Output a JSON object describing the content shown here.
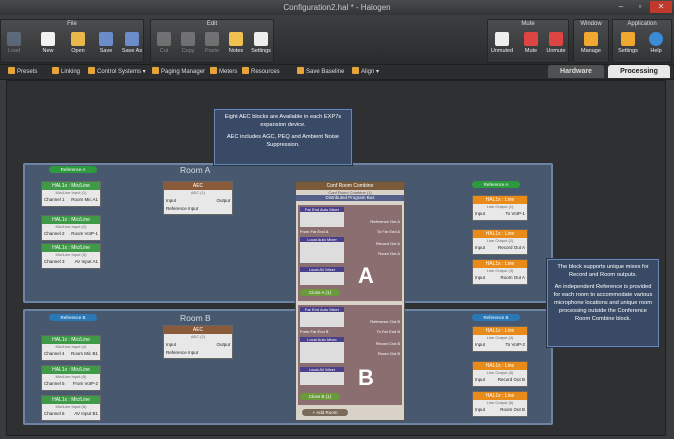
{
  "window": {
    "title": "Configuration2.hal * - Halogen"
  },
  "ribbon": {
    "groups": [
      {
        "title": "File",
        "items": [
          {
            "label": "Load",
            "icon": "load-icon",
            "enabled": false
          },
          {
            "label": "New",
            "icon": "new-icon"
          },
          {
            "label": "Open",
            "icon": "open-icon"
          },
          {
            "label": "Save",
            "icon": "save-icon"
          },
          {
            "label": "Save As",
            "icon": "save-as-icon"
          }
        ]
      },
      {
        "title": "Edit",
        "items": [
          {
            "label": "Cut",
            "icon": "cut-icon",
            "enabled": false
          },
          {
            "label": "Copy",
            "icon": "copy-icon",
            "enabled": false
          },
          {
            "label": "Paste",
            "icon": "paste-icon",
            "enabled": false
          },
          {
            "label": "Notes",
            "icon": "notes-icon"
          },
          {
            "label": "Settings",
            "icon": "settings-icon"
          }
        ]
      },
      {
        "title": "Mute",
        "items": [
          {
            "label": "Unmuted",
            "icon": "speaker-icon"
          },
          {
            "label": "Mute",
            "icon": "mute-icon"
          },
          {
            "label": "Unmute",
            "icon": "unmute-icon"
          }
        ]
      },
      {
        "title": "Window",
        "items": [
          {
            "label": "Manage",
            "icon": "window-icon"
          }
        ]
      },
      {
        "title": "Application",
        "items": [
          {
            "label": "Settings",
            "icon": "gear-icon"
          },
          {
            "label": "Help",
            "icon": "help-icon"
          }
        ]
      }
    ]
  },
  "toolbar": {
    "items": [
      "Presets",
      "Linking",
      "Control Systems",
      "Paging Manager",
      "Meters",
      "Resources",
      "Save Baseline",
      "Align"
    ]
  },
  "tabs": {
    "hardware": "Hardware",
    "processing": "Processing"
  },
  "callouts": {
    "top": "Eight AEC blocks are Available in each EXP7s expansion device.",
    "top2": "AEC includes AGC, PEQ and Ambient Noise Suppression.",
    "right1": "The block supports unique mixes for Record and Room outputs.",
    "right2": "An independent Reference is provided for each room to accommodate various microphone locations and unique room processing outside the Conference Room Combine block."
  },
  "roomA": {
    "title": "Room A",
    "reference": "Reference A",
    "refOut": "Reference A",
    "inputs": [
      {
        "title": "HAL1x : Mic/Line",
        "sub": "Mic/Line Input (1)",
        "ch": "Channel 1",
        "name": "Room Mic A1"
      },
      {
        "title": "HAL1x : Mic/Line",
        "sub": "Mic/Line Input (2)",
        "ch": "Channel 2",
        "name": "Room VoIP-1"
      },
      {
        "title": "HAL1x : Mic/Line",
        "sub": "Mic/Line Input (3)",
        "ch": "Channel 3",
        "name": "AV Input A1"
      }
    ],
    "aec": {
      "title": "AEC",
      "sub": "AEC (1)",
      "input": "Input",
      "ref": "Reference Input",
      "output": "Output"
    },
    "outputs": [
      {
        "title": "HAL1x : Line",
        "sub": "Line Output (1)",
        "io": "Input",
        "name": "To VoIP-1"
      },
      {
        "title": "HAL1x : Line",
        "sub": "Line Output (2)",
        "io": "Input",
        "name": "Record Out A"
      },
      {
        "title": "HAL1x : Line",
        "sub": "Line Output (3)",
        "io": "Input",
        "name": "Room Out A"
      }
    ],
    "letter": "A"
  },
  "roomB": {
    "title": "Room B",
    "reference": "Reference B",
    "refOut": "Reference B",
    "inputs": [
      {
        "title": "HAL1x : Mic/Line",
        "sub": "Mic/Line Input (4)",
        "ch": "Channel 4",
        "name": "Room Mic B1"
      },
      {
        "title": "HAL1x : Mic/Line",
        "sub": "Mic/Line Input (5)",
        "ch": "Channel 5",
        "name": "From VoIP-2"
      },
      {
        "title": "HAL1x : Mic/Line",
        "sub": "Mic/Line Input (6)",
        "ch": "Channel 6",
        "name": "AV Input B1"
      }
    ],
    "aec": {
      "title": "AEC",
      "sub": "AEC (2)",
      "input": "Input",
      "ref": "Reference Input",
      "output": "Output"
    },
    "outputs": [
      {
        "title": "HAL1x : Line",
        "sub": "Line Output (4)",
        "io": "Input",
        "name": "To VoIP-2"
      },
      {
        "title": "HAL1x : Line",
        "sub": "Line Output (5)",
        "io": "Input",
        "name": "Record Out B"
      },
      {
        "title": "HAL1x : Line",
        "sub": "Line Output (6)",
        "io": "Input",
        "name": "Room Out B"
      }
    ],
    "letter": "B"
  },
  "combine": {
    "title": "Conf Room Combine",
    "sub": "Conf Room Combine (1)",
    "dist": "Distributed Program Bus",
    "farEndA": "Far End Auto Mixer",
    "localAutoA": "Local Auto Mixer",
    "localAvA": "Local AV Mixer",
    "refOutA": "Reference Out A",
    "toFarEndA": "To Far End A",
    "recordOutA": "Record Out A",
    "roomOutA": "Room Out A",
    "fromFarEndA": "From Far End A",
    "closeA": "Close A (1)",
    "refOutB": "Reference Out B",
    "toFarEndB": "To Far End B",
    "recordOutB": "Record Out B",
    "roomOutB": "Room Out B",
    "fromFarEndB": "From Far End B",
    "closeB": "Close B (1)",
    "addRoom": "Add Room"
  },
  "colors": {
    "green": "#3f9a48",
    "orange": "#e88b1a",
    "aec": "#8a5a3a",
    "room": "#48586e",
    "accent": "#e8a33a"
  }
}
